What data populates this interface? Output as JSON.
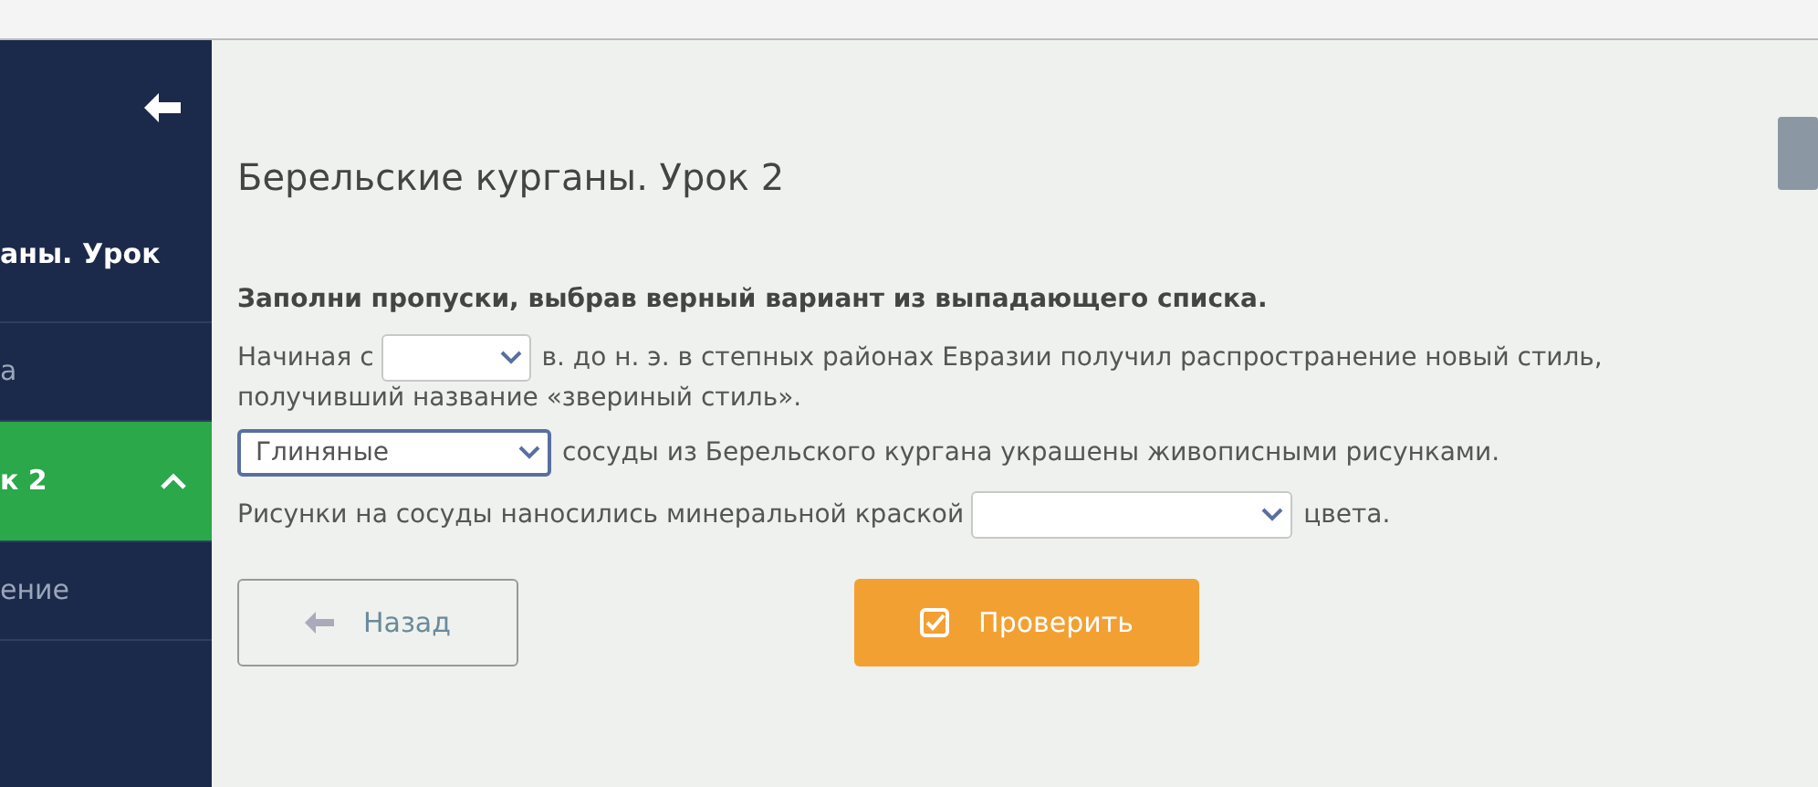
{
  "sidebar": {
    "title": "аны. Урок",
    "items": [
      {
        "label": "а",
        "selected": false,
        "expanded": false
      },
      {
        "label": "к 2",
        "selected": true,
        "expanded": true
      },
      {
        "label": "ение",
        "selected": false,
        "expanded": false
      }
    ]
  },
  "lesson_title": "Берельские курганы. Урок 2",
  "instruction": "Заполни пропуски, выбрав верный вариант из выпадающего списка.",
  "sentences": [
    {
      "parts": [
        {
          "kind": "text",
          "text": "Начиная с"
        },
        {
          "kind": "select"
        },
        {
          "kind": "text",
          "text": "в. до н. э. в степных районах Евразии получил распространение новый стиль,"
        },
        {
          "kind": "line",
          "text": "получивший название «звериный стиль»."
        }
      ]
    },
    {
      "parts": [
        {
          "kind": "select",
          "value": "Глиняные"
        },
        {
          "kind": "text",
          "text": "сосуды из Берельского кургана украшены живописными рисунками."
        }
      ]
    },
    {
      "parts": [
        {
          "kind": "text",
          "text": "Рисунки на сосуды наносились минеральной краской"
        },
        {
          "kind": "select"
        },
        {
          "kind": "text",
          "text": "цвета."
        }
      ]
    }
  ],
  "buttons": [
    {
      "kind": "back",
      "label": "Назад"
    },
    {
      "kind": "check",
      "label": "Проверить"
    }
  ]
}
